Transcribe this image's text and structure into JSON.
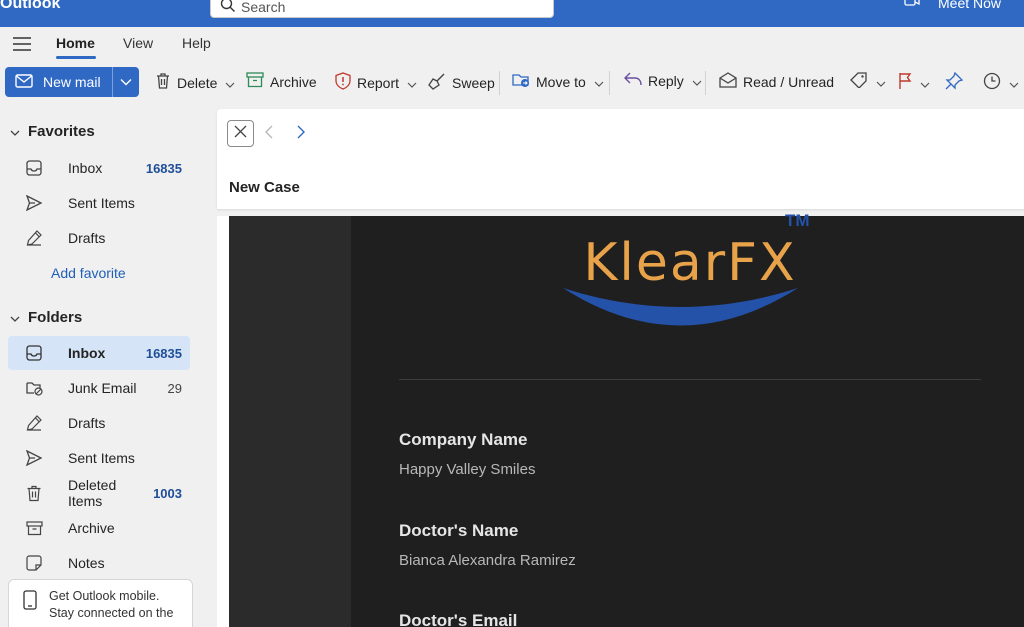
{
  "app": {
    "title": "Outlook"
  },
  "search": {
    "placeholder": "Search"
  },
  "header": {
    "meet_now": "Meet Now"
  },
  "tabs": [
    {
      "label": "Home",
      "active": true
    },
    {
      "label": "View"
    },
    {
      "label": "Help"
    }
  ],
  "ribbon": {
    "new_mail": "New mail",
    "delete": "Delete",
    "archive": "Archive",
    "report": "Report",
    "sweep": "Sweep",
    "move_to": "Move to",
    "reply": "Reply",
    "read_unread": "Read / Unread"
  },
  "sidebar": {
    "favorites_label": "Favorites",
    "favorites": [
      {
        "label": "Inbox",
        "count": "16835",
        "icon": "inbox-icon"
      },
      {
        "label": "Sent Items",
        "count": "",
        "icon": "send-icon"
      },
      {
        "label": "Drafts",
        "count": "",
        "icon": "draft-icon"
      }
    ],
    "add_favorite": "Add favorite",
    "folders_label": "Folders",
    "folders": [
      {
        "label": "Inbox",
        "count": "16835",
        "icon": "inbox-icon",
        "selected": true
      },
      {
        "label": "Junk Email",
        "count": "29",
        "icon": "junk-icon"
      },
      {
        "label": "Drafts",
        "count": "",
        "icon": "draft-icon"
      },
      {
        "label": "Sent Items",
        "count": "",
        "icon": "send-icon"
      },
      {
        "label": "Deleted Items",
        "count": "1003",
        "icon": "trash-icon"
      },
      {
        "label": "Archive",
        "count": "",
        "icon": "archive-icon"
      },
      {
        "label": "Notes",
        "count": "",
        "icon": "note-icon"
      }
    ],
    "promo": {
      "line1": "Get Outlook mobile.",
      "line2": "Stay connected on the"
    }
  },
  "message": {
    "subject": "New Case",
    "logo_text": "KlearFX",
    "logo_tm": "TM",
    "fields": [
      {
        "label": "Company Name",
        "value": "Happy Valley Smiles"
      },
      {
        "label": "Doctor's Name",
        "value": "Bianca Alexandra Ramirez"
      },
      {
        "label": "Doctor's Email",
        "value": ""
      }
    ]
  },
  "colors": {
    "brand_blue": "#2f69c4",
    "logo_orange": "#e8a24a",
    "logo_blue": "#2452a8"
  }
}
